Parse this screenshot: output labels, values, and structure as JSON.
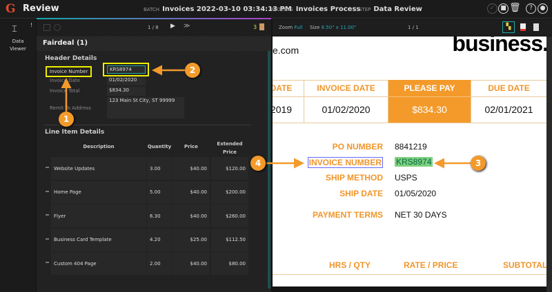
{
  "app": {
    "title": "Review",
    "logo": "G"
  },
  "breadcrumb": {
    "batch_label": "BATCH",
    "batch": "Invoices 2022-03-10 03:34:13 PM",
    "process_label": "PROCESS",
    "process": "Invoices Process",
    "step_label": "STEP",
    "step": "Data Review"
  },
  "rail": {
    "item": "Data Viewer",
    "alert": "!"
  },
  "left_toolbar": {
    "page": "1",
    "total": "/ 8",
    "doc_count": "3"
  },
  "document_title": "Fairdeal (1)",
  "header_details": {
    "title": "Header Details",
    "fields": [
      {
        "label": "Invoice Number",
        "value": "KRS8974"
      },
      {
        "label": "Invoice Date",
        "value": "01/02/2020"
      },
      {
        "label": "Invoice Total",
        "value": "$834.30"
      },
      {
        "label": "Remit To Address",
        "value": "123 Main St City, ST 99999"
      }
    ]
  },
  "line_items": {
    "title": "Line Item Details",
    "columns": [
      "Description",
      "Quantity",
      "Price",
      "Extended Price"
    ],
    "rows": [
      [
        "Website Updates",
        "3.00",
        "$40.00",
        "$120.00"
      ],
      [
        "Home Page",
        "5.00",
        "$40.00",
        "$200.00"
      ],
      [
        "Flyer",
        "6.30",
        "$40.00",
        "$260.00"
      ],
      [
        "Business Card Template",
        "4.20",
        "$25.00",
        "$112.50"
      ],
      [
        "Custom 404 Page",
        "2.00",
        "$40.00",
        "$80.00"
      ]
    ]
  },
  "viewer_toolbar": {
    "zoom_label": "Zoom",
    "zoom": "Full",
    "size_label": "Size",
    "size": "8.50\" x 11.00\"",
    "page": "1",
    "total": "/ 1"
  },
  "invoice": {
    "site": "e.com",
    "brand": "business.",
    "summary": [
      {
        "h": "DATE",
        "v": "2019"
      },
      {
        "h": "INVOICE DATE",
        "v": "01/02/2020"
      },
      {
        "h": "PLEASE PAY",
        "v": "$834.30"
      },
      {
        "h": "DUE DATE",
        "v": "02/01/2021"
      }
    ],
    "fields": [
      {
        "label": "PO NUMBER",
        "value": "8841219"
      },
      {
        "label": "INVOICE NUMBER",
        "value": "KRS8974"
      },
      {
        "label": "SHIP METHOD",
        "value": "USPS"
      },
      {
        "label": "SHIP DATE",
        "value": "01/05/2020"
      },
      {
        "label": "PAYMENT TERMS",
        "value": "NET 30 DAYS"
      }
    ],
    "table_headers": [
      "HRS / QTY",
      "RATE / PRICE",
      "SUBTOTAL"
    ]
  },
  "annotations": [
    "1",
    "2",
    "3",
    "4"
  ],
  "colors": {
    "accent": "#f39a2b",
    "teal": "#1aa0a0"
  }
}
